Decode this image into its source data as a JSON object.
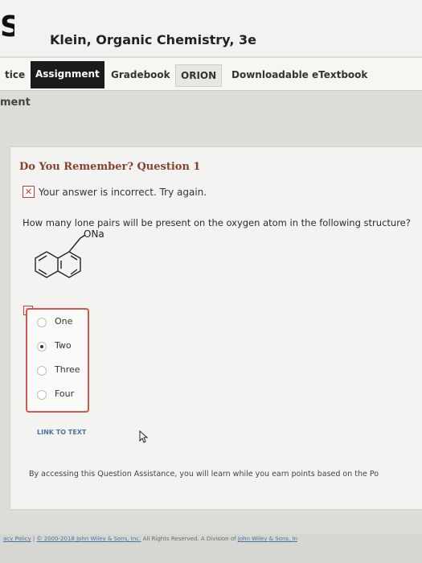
{
  "header": {
    "logo_letter": "S",
    "title": "Klein, Organic Chemistry, 3e"
  },
  "tabs": [
    {
      "label": "tice"
    },
    {
      "label": "Assignment"
    },
    {
      "label": "Gradebook"
    },
    {
      "label": "ORION"
    },
    {
      "label": "Downloadable eTextbook"
    }
  ],
  "section": {
    "label": "ment"
  },
  "question": {
    "title": "Do You Remember? Question 1",
    "feedback": "Your answer is incorrect.  Try again.",
    "text": "How many lone pairs will be present on the oxygen atom in the following structure?",
    "structure_label": "ONa",
    "options": [
      {
        "label": "One",
        "selected": false
      },
      {
        "label": "Two",
        "selected": true
      },
      {
        "label": "Three",
        "selected": false
      },
      {
        "label": "Four",
        "selected": false
      }
    ],
    "link_to_text": "LINK TO TEXT"
  },
  "assistance_note": "By accessing this Question Assistance, you will learn while you earn points based on the Po",
  "footer": {
    "privacy_link": "acy Policy",
    "separator": "|",
    "copyright": "© 2000-2018 John Wiley & Sons, Inc.",
    "rights": "All Rights Reserved. A Division of ",
    "company": "John Wiley & Sons, In"
  },
  "colors": {
    "question_title": "#8a3f2c",
    "error": "#d23a2e",
    "link": "#4b74a6",
    "active_tab": "#1b1b1b"
  }
}
